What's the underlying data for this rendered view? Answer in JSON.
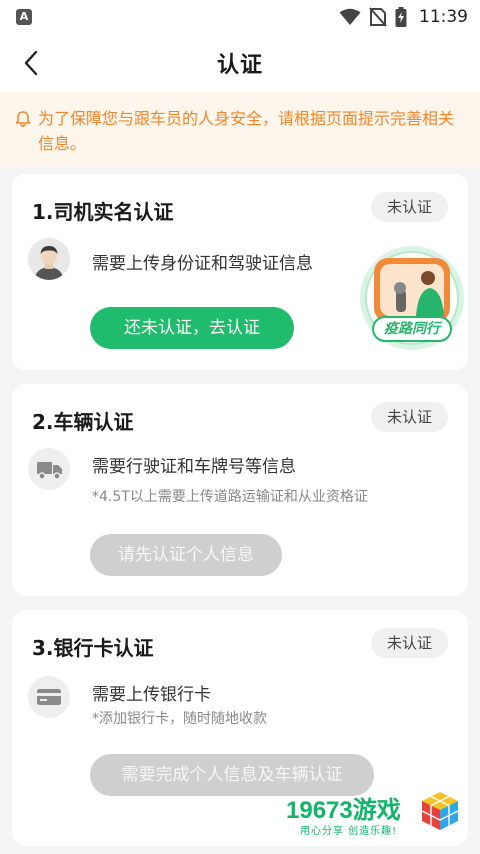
{
  "status_bar": {
    "app_icon_letter": "A",
    "time": "11:39",
    "icons": [
      "wifi-icon",
      "no-sim-icon",
      "battery-charging-icon"
    ]
  },
  "header": {
    "title": "认证",
    "back_icon": "chevron-left-icon"
  },
  "notice": {
    "icon": "bell-icon",
    "text": "为了保障您与跟车员的人身安全，请根据页面提示完善相关信息。",
    "color": "#f0862d",
    "background": "#fdf6ec"
  },
  "cards": [
    {
      "title": "1.司机实名认证",
      "status": "未认证",
      "icon": "user-avatar-icon",
      "description": "需要上传身份证和驾驶证信息",
      "note": "",
      "button": "还未认证，去认证",
      "button_enabled": true
    },
    {
      "title": "2.车辆认证",
      "status": "未认证",
      "icon": "truck-icon",
      "description": "需要行驶证和车牌号等信息",
      "note": "*4.5T以上需要上传道路运输证和从业资格证",
      "button": "请先认证个人信息",
      "button_enabled": false
    },
    {
      "title": "3.银行卡认证",
      "status": "未认证",
      "icon": "bank-card-icon",
      "description": "需要上传银行卡",
      "note": "*添加银行卡，随时随地收款",
      "button": "需要完成个人信息及车辆认证",
      "button_enabled": false
    }
  ],
  "mascot": {
    "icon": "driver-mascot-icon",
    "label": "疫路同行"
  },
  "watermark": {
    "title": "19673游戏",
    "subtitle": "用心分享 创造乐趣!",
    "icon": "game-cube-logo"
  },
  "colors": {
    "accent_green": "#1ebc6c",
    "disabled_button": "#cfcfcf",
    "page_background": "#f3f4f6"
  }
}
